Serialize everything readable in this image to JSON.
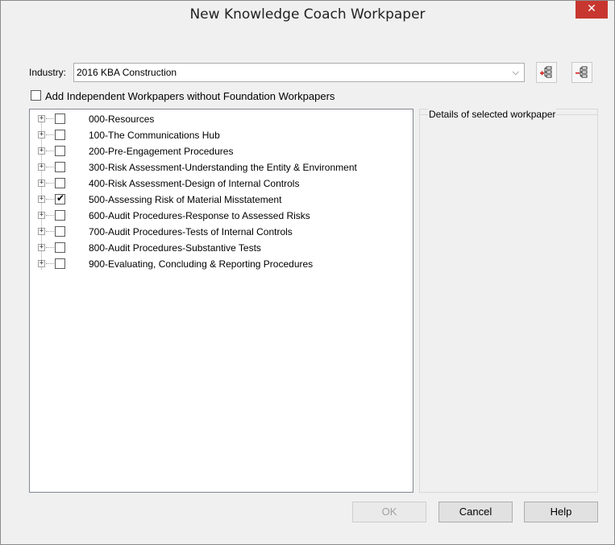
{
  "window": {
    "title": "New Knowledge Coach Workpaper",
    "close_glyph": "✕"
  },
  "industry": {
    "label": "Industry:",
    "selected": "2016 KBA Construction",
    "add_button_icon": "add-tree-icon",
    "remove_button_icon": "remove-tree-icon"
  },
  "add_independent": {
    "label": "Add Independent Workpapers without Foundation Workpapers",
    "checked": false
  },
  "tree": {
    "items": [
      {
        "label": "000-Resources",
        "checked": false
      },
      {
        "label": "100-The Communications Hub",
        "checked": false
      },
      {
        "label": "200-Pre-Engagement Procedures",
        "checked": false
      },
      {
        "label": "300-Risk Assessment-Understanding the Entity & Environment",
        "checked": false
      },
      {
        "label": "400-Risk Assessment-Design of Internal Controls",
        "checked": false
      },
      {
        "label": "500-Assessing Risk of Material Misstatement",
        "checked": true
      },
      {
        "label": "600-Audit Procedures-Response to Assessed Risks",
        "checked": false
      },
      {
        "label": "700-Audit Procedures-Tests of Internal Controls",
        "checked": false
      },
      {
        "label": "800-Audit Procedures-Substantive Tests",
        "checked": false
      },
      {
        "label": "900-Evaluating, Concluding & Reporting Procedures",
        "checked": false
      }
    ]
  },
  "details": {
    "legend": "Details of selected workpaper"
  },
  "buttons": {
    "ok": "OK",
    "cancel": "Cancel",
    "help": "Help"
  }
}
